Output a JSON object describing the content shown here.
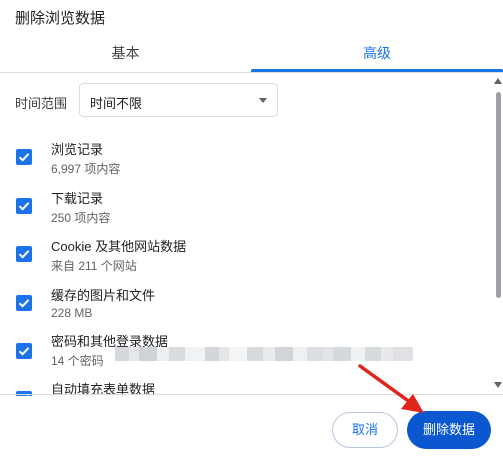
{
  "dialog": {
    "title": "删除浏览数据"
  },
  "tabs": [
    {
      "label": "基本",
      "active": false
    },
    {
      "label": "高级",
      "active": true
    }
  ],
  "time_range": {
    "label": "时间范围",
    "selected": "时间不限"
  },
  "items": [
    {
      "title": "浏览记录",
      "subtitle": "6,997 项内容",
      "checked": true
    },
    {
      "title": "下载记录",
      "subtitle": "250 项内容",
      "checked": true
    },
    {
      "title": "Cookie 及其他网站数据",
      "subtitle": "来自 211 个网站",
      "checked": true
    },
    {
      "title": "缓存的图片和文件",
      "subtitle": "228 MB",
      "checked": true
    },
    {
      "title": "密码和其他登录数据",
      "subtitle": "14 个密码",
      "checked": true
    },
    {
      "title": "自动填充表单数据",
      "subtitle": "",
      "checked": true
    }
  ],
  "buttons": {
    "cancel": "取消",
    "delete": "删除数据"
  },
  "colors": {
    "accent": "#1a73e8",
    "primary_button": "#0b57d0",
    "annotation_arrow": "#e0241c"
  },
  "icons": {
    "checkbox": "check-icon",
    "dropdown": "caret-down-icon",
    "annotation": "red-arrow-icon"
  }
}
